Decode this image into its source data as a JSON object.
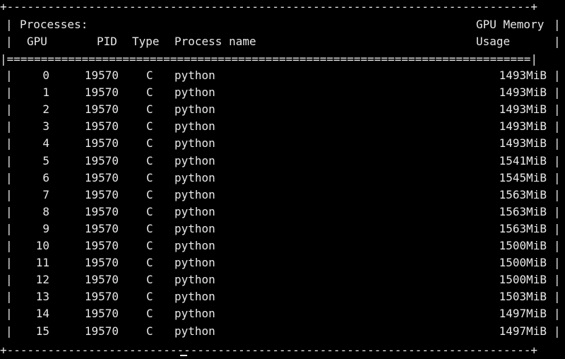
{
  "terminal": {
    "border_char": "|",
    "top_rule": "+-----------------------------------------------------------------------------+",
    "double_rule": "|=============================================================================|",
    "bottom_rule": "+-----------------------------------------------------------------------------+",
    "section_title": "Processes:",
    "header_memory_top": "GPU Memory",
    "columns": {
      "gpu": "GPU",
      "pid": "PID",
      "type": "Type",
      "process_name": "Process name",
      "usage": "Usage"
    },
    "rows": [
      {
        "gpu": "0",
        "pid": "19570",
        "type": "C",
        "name": "python",
        "mem": "1493MiB"
      },
      {
        "gpu": "1",
        "pid": "19570",
        "type": "C",
        "name": "python",
        "mem": "1493MiB"
      },
      {
        "gpu": "2",
        "pid": "19570",
        "type": "C",
        "name": "python",
        "mem": "1493MiB"
      },
      {
        "gpu": "3",
        "pid": "19570",
        "type": "C",
        "name": "python",
        "mem": "1493MiB"
      },
      {
        "gpu": "4",
        "pid": "19570",
        "type": "C",
        "name": "python",
        "mem": "1493MiB"
      },
      {
        "gpu": "5",
        "pid": "19570",
        "type": "C",
        "name": "python",
        "mem": "1541MiB"
      },
      {
        "gpu": "6",
        "pid": "19570",
        "type": "C",
        "name": "python",
        "mem": "1545MiB"
      },
      {
        "gpu": "7",
        "pid": "19570",
        "type": "C",
        "name": "python",
        "mem": "1563MiB"
      },
      {
        "gpu": "8",
        "pid": "19570",
        "type": "C",
        "name": "python",
        "mem": "1563MiB"
      },
      {
        "gpu": "9",
        "pid": "19570",
        "type": "C",
        "name": "python",
        "mem": "1563MiB"
      },
      {
        "gpu": "10",
        "pid": "19570",
        "type": "C",
        "name": "python",
        "mem": "1500MiB"
      },
      {
        "gpu": "11",
        "pid": "19570",
        "type": "C",
        "name": "python",
        "mem": "1500MiB"
      },
      {
        "gpu": "12",
        "pid": "19570",
        "type": "C",
        "name": "python",
        "mem": "1500MiB"
      },
      {
        "gpu": "13",
        "pid": "19570",
        "type": "C",
        "name": "python",
        "mem": "1503MiB"
      },
      {
        "gpu": "14",
        "pid": "19570",
        "type": "C",
        "name": "python",
        "mem": "1497MiB"
      },
      {
        "gpu": "15",
        "pid": "19570",
        "type": "C",
        "name": "python",
        "mem": "1497MiB"
      }
    ],
    "colors": {
      "background": "#000000",
      "foreground": "#e8e8e8"
    }
  }
}
